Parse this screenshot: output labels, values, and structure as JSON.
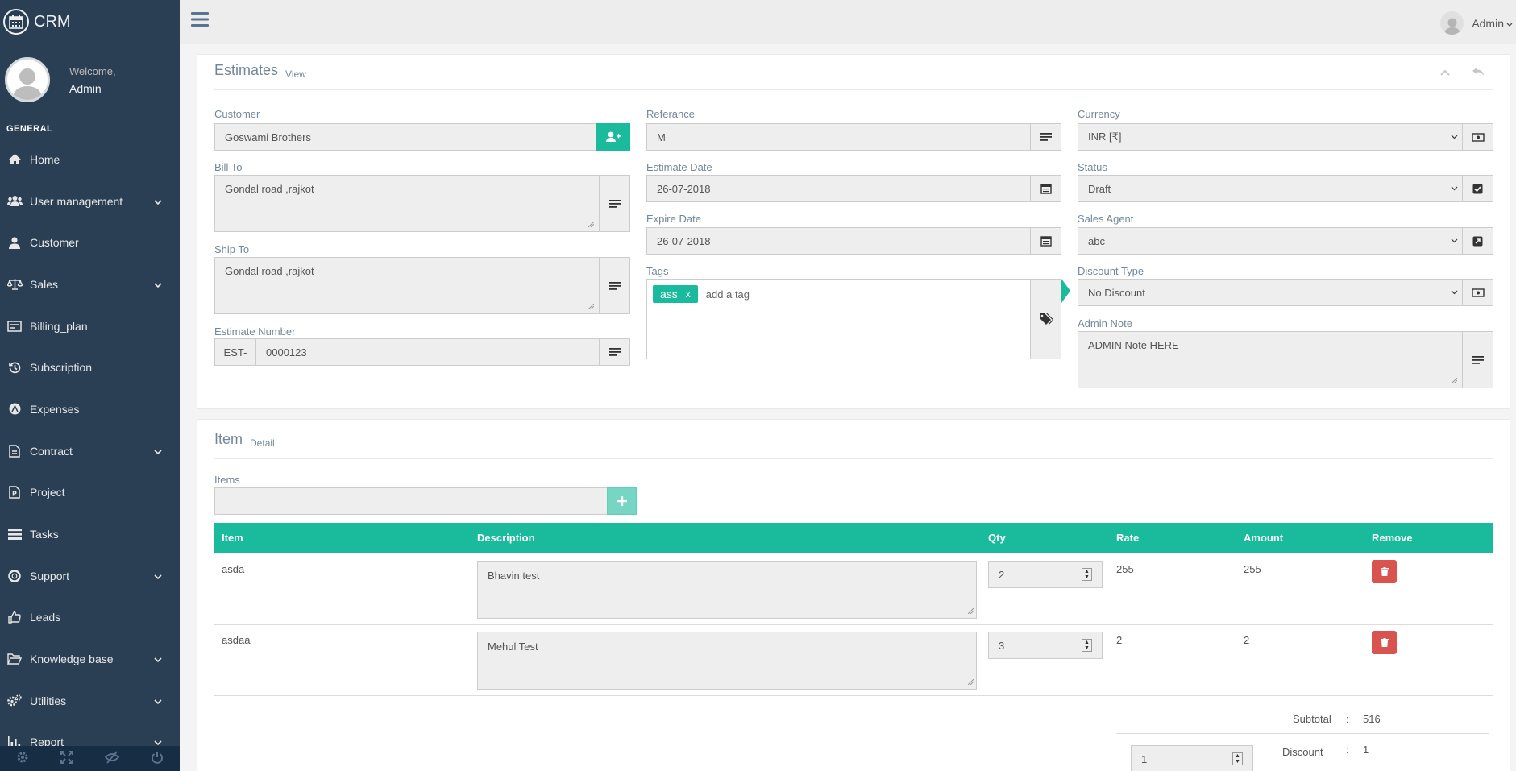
{
  "app": {
    "name": "CRM"
  },
  "profile": {
    "welcome": "Welcome,",
    "name": "Admin"
  },
  "sidebar": {
    "section": "GENERAL",
    "items": [
      {
        "label": "Home",
        "icon": "home-icon",
        "has_children": false
      },
      {
        "label": "User management",
        "icon": "users-icon",
        "has_children": true
      },
      {
        "label": "Customer",
        "icon": "user-icon",
        "has_children": false
      },
      {
        "label": "Sales",
        "icon": "balance-scale-icon",
        "has_children": true
      },
      {
        "label": "Billing_plan",
        "icon": "billing-icon",
        "has_children": false
      },
      {
        "label": "Subscription",
        "icon": "history-icon",
        "has_children": false
      },
      {
        "label": "Expenses",
        "icon": "expenses-icon",
        "has_children": false
      },
      {
        "label": "Contract",
        "icon": "file-icon",
        "has_children": true
      },
      {
        "label": "Project",
        "icon": "project-icon",
        "has_children": false
      },
      {
        "label": "Tasks",
        "icon": "tasks-icon",
        "has_children": false
      },
      {
        "label": "Support",
        "icon": "life-ring-icon",
        "has_children": true
      },
      {
        "label": "Leads",
        "icon": "thumbs-up-icon",
        "has_children": false
      },
      {
        "label": "Knowledge base",
        "icon": "folder-open-icon",
        "has_children": true
      },
      {
        "label": "Utilities",
        "icon": "cogs-icon",
        "has_children": true
      },
      {
        "label": "Report",
        "icon": "bar-chart-icon",
        "has_children": true
      }
    ],
    "footer_icons": [
      "settings-icon",
      "fullscreen-icon",
      "lock-icon",
      "power-icon"
    ]
  },
  "topbar": {
    "user": "Admin"
  },
  "estimates": {
    "title": "Estimates",
    "subtitle": "View",
    "customer": {
      "label": "Customer",
      "value": "Goswami Brothers"
    },
    "bill_to": {
      "label": "Bill To",
      "value": "Gondal road ,rajkot"
    },
    "ship_to": {
      "label": "Ship To",
      "value": "Gondal road ,rajkot"
    },
    "estimate_number": {
      "label": "Estimate Number",
      "prefix": "EST-",
      "value": "0000123"
    },
    "reference": {
      "label": "Referance",
      "value": "M"
    },
    "estimate_date": {
      "label": "Estimate Date",
      "value": "26-07-2018"
    },
    "expire_date": {
      "label": "Expire Date",
      "value": "26-07-2018"
    },
    "tags": {
      "label": "Tags",
      "items": [
        "ass"
      ],
      "remove": "x",
      "placeholder": "add a tag"
    },
    "currency": {
      "label": "Currency",
      "value": "INR [₹]"
    },
    "status": {
      "label": "Status",
      "value": "Draft"
    },
    "sales_agent": {
      "label": "Sales Agent",
      "value": "abc"
    },
    "discount_type": {
      "label": "Discount Type",
      "value": "No Discount"
    },
    "admin_note": {
      "label": "Admin Note",
      "value": "ADMIN Note HERE"
    }
  },
  "item": {
    "title": "Item",
    "subtitle": "Detail",
    "items_label": "Items",
    "columns": [
      "Item",
      "Description",
      "Qty",
      "Rate",
      "Amount",
      "Remove"
    ],
    "rows": [
      {
        "item": "asda",
        "description": "Bhavin test",
        "qty": "2",
        "rate": "255",
        "amount": "255"
      },
      {
        "item": "asdaa",
        "description": "Mehul Test",
        "qty": "3",
        "rate": "2",
        "amount": "2"
      }
    ],
    "subtotal": {
      "label": "Subtotal",
      "sep": ":",
      "value": "516"
    },
    "discount": {
      "label": "Discount",
      "sep": ":",
      "value": "1",
      "input": "1"
    }
  },
  "colors": {
    "sidebar": "#2a3f54",
    "accent": "#1abb9c",
    "danger": "#d9534f"
  }
}
